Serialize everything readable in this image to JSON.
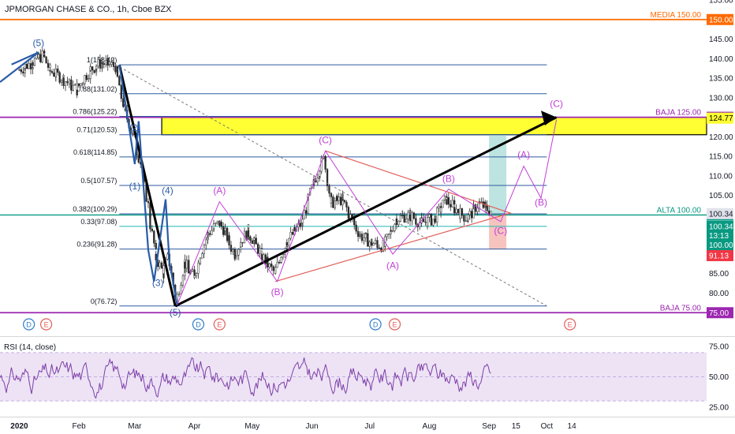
{
  "header": {
    "title": "JPMORGAN CHASE & CO., 1h, Cboe BZX"
  },
  "colors": {
    "candles": "#2a2a2a",
    "wave_black": "#000000",
    "wave_blue": "#2a5ca8",
    "wave_magenta": "#c23fd6",
    "triangle": "#e0605a",
    "fib": "#2f5aa0",
    "fib_33": "#1fb7b0",
    "media": "#ff6a00",
    "baja": "#9c27b0",
    "alta": "#089981",
    "yellow_zone": "#ffff33",
    "teal_box": "#b2dfdb",
    "pink_box": "#f4b8b4",
    "rsi": "#7e3ea8",
    "rsi_band": "#ede3f5"
  },
  "chart_data": {
    "type": "candlestick",
    "symbol": "JPMORGAN CHASE & CO.",
    "interval": "1h",
    "exchange": "Cboe BZX",
    "x_range": [
      "2019-12-22",
      "2020-12-23"
    ],
    "ylim": [
      69,
      155
    ],
    "y_ticks": [
      80,
      85,
      90,
      95,
      100,
      105,
      110,
      115,
      120,
      125,
      130,
      135,
      140,
      145,
      150,
      155
    ],
    "x_ticks": [
      {
        "label": "2020",
        "date": "2020-01-01"
      },
      {
        "label": "Feb",
        "date": "2020-02-01"
      },
      {
        "label": "Mar",
        "date": "2020-03-01"
      },
      {
        "label": "Apr",
        "date": "2020-04-01"
      },
      {
        "label": "May",
        "date": "2020-05-01"
      },
      {
        "label": "Jun",
        "date": "2020-06-01"
      },
      {
        "label": "Jul",
        "date": "2020-07-01"
      },
      {
        "label": "Aug",
        "date": "2020-08-01"
      },
      {
        "label": "Sep",
        "date": "2020-09-01"
      },
      {
        "label": "15",
        "date": "2020-09-15"
      },
      {
        "label": "Oct",
        "date": "2020-10-01"
      },
      {
        "label": "14",
        "date": "2020-10-14"
      }
    ],
    "price_path": [
      [
        "2020-01-01",
        137
      ],
      [
        "2020-01-08",
        139
      ],
      [
        "2020-01-14",
        141
      ],
      [
        "2020-01-17",
        137
      ],
      [
        "2020-01-24",
        135
      ],
      [
        "2020-01-31",
        132
      ],
      [
        "2020-02-07",
        137
      ],
      [
        "2020-02-13",
        139
      ],
      [
        "2020-02-20",
        138
      ],
      [
        "2020-02-25",
        127
      ],
      [
        "2020-03-02",
        118
      ],
      [
        "2020-03-05",
        112
      ],
      [
        "2020-03-09",
        100
      ],
      [
        "2020-03-12",
        90
      ],
      [
        "2020-03-16",
        85
      ],
      [
        "2020-03-19",
        90
      ],
      [
        "2020-03-23",
        77
      ],
      [
        "2020-03-27",
        88
      ],
      [
        "2020-04-01",
        84
      ],
      [
        "2020-04-08",
        95
      ],
      [
        "2020-04-14",
        98
      ],
      [
        "2020-04-17",
        96
      ],
      [
        "2020-04-22",
        90
      ],
      [
        "2020-04-29",
        96
      ],
      [
        "2020-05-06",
        90
      ],
      [
        "2020-05-13",
        85
      ],
      [
        "2020-05-19",
        93
      ],
      [
        "2020-05-27",
        98
      ],
      [
        "2020-06-02",
        108
      ],
      [
        "2020-06-08",
        115
      ],
      [
        "2020-06-11",
        103
      ],
      [
        "2020-06-17",
        104
      ],
      [
        "2020-06-26",
        95
      ],
      [
        "2020-07-02",
        93
      ],
      [
        "2020-07-09",
        92
      ],
      [
        "2020-07-15",
        99
      ],
      [
        "2020-07-22",
        100
      ],
      [
        "2020-07-28",
        98
      ],
      [
        "2020-08-04",
        99
      ],
      [
        "2020-08-10",
        104
      ],
      [
        "2020-08-14",
        102
      ],
      [
        "2020-08-21",
        99
      ],
      [
        "2020-08-27",
        103
      ],
      [
        "2020-09-02",
        101
      ]
    ],
    "horizontal_levels": [
      {
        "name": "MEDIA",
        "label": "MEDIA 150.00",
        "price": 150.0,
        "tag": "150.00",
        "color": "#ff6a00"
      },
      {
        "name": "BAJA",
        "label": "BAJA 125.00",
        "price": 125.0,
        "tag": "125.00",
        "color": "#9c27b0"
      },
      {
        "name": "ALTA",
        "label": "ALTA 100.00",
        "price": 100.0,
        "tag": "100.00",
        "color": "#089981"
      },
      {
        "name": "BAJA",
        "label": "BAJA 75.00",
        "price": 75.0,
        "tag": "75.00",
        "color": "#9c27b0"
      }
    ],
    "fib_levels": [
      {
        "label": "1(138.42)",
        "price": 138.42
      },
      {
        "label": "0.88(131.02)",
        "price": 131.02
      },
      {
        "label": "0.786(125.22)",
        "price": 125.22
      },
      {
        "label": "0.71(120.53)",
        "price": 120.53
      },
      {
        "label": "0.618(114.85)",
        "price": 114.85
      },
      {
        "label": "0.5(107.57)",
        "price": 107.57
      },
      {
        "label": "0.382(100.29)",
        "price": 100.29
      },
      {
        "label": "0.33(97.08)",
        "price": 97.08
      },
      {
        "label": "0.236(91.28)",
        "price": 91.28
      },
      {
        "label": "0(76.72)",
        "price": 76.72
      }
    ],
    "price_tags": [
      {
        "text": "124.77",
        "price": 124.77,
        "style": "yellow"
      },
      {
        "text": "100.34",
        "price": 100.34,
        "style": "grey"
      },
      {
        "text": "100.34",
        "price": 97.1,
        "style": "green"
      },
      {
        "text": "13:13",
        "price": 94.7,
        "style": "green"
      },
      {
        "text": "100.00",
        "price": 92.3,
        "style": "green"
      },
      {
        "text": "91.13",
        "price": 89.6,
        "style": "red"
      }
    ],
    "wave_labels": [
      {
        "text": "(5)",
        "date": "2020-01-11",
        "price": 143.2,
        "color": "#2a5ca8"
      },
      {
        "text": "(2)",
        "date": "2020-03-01",
        "price": 121.5,
        "color": "#2a5ca8"
      },
      {
        "text": "(1)",
        "date": "2020-03-01",
        "price": 106.5,
        "color": "#2a5ca8"
      },
      {
        "text": "(4)",
        "date": "2020-03-18",
        "price": 105.4,
        "color": "#2a5ca8"
      },
      {
        "text": "(3)",
        "date": "2020-03-13",
        "price": 81.8,
        "color": "#2a5ca8"
      },
      {
        "text": "(5)",
        "date": "2020-03-22",
        "price": 74.2,
        "color": "#2a5ca8"
      },
      {
        "text": "(A)",
        "date": "2020-04-14",
        "price": 105.4,
        "color": "#c23fd6"
      },
      {
        "text": "(B)",
        "date": "2020-05-14",
        "price": 79.5,
        "color": "#c23fd6"
      },
      {
        "text": "(C)",
        "date": "2020-06-08",
        "price": 118.4,
        "color": "#c23fd6"
      },
      {
        "text": "(A)",
        "date": "2020-07-13",
        "price": 86.3,
        "color": "#c23fd6"
      },
      {
        "text": "(B)",
        "date": "2020-08-11",
        "price": 108.5,
        "color": "#c23fd6"
      },
      {
        "text": "(C)",
        "date": "2020-09-07",
        "price": 95.1,
        "color": "#c23fd6"
      },
      {
        "text": "(A)",
        "date": "2020-09-19",
        "price": 114.6,
        "color": "#c23fd6"
      },
      {
        "text": "(B)",
        "date": "2020-09-28",
        "price": 102.4,
        "color": "#c23fd6"
      },
      {
        "text": "(C)",
        "date": "2020-10-06",
        "price": 127.6,
        "color": "#c23fd6"
      }
    ],
    "events": [
      {
        "letter": "D",
        "date": "2020-01-06",
        "kind": "dividend"
      },
      {
        "letter": "E",
        "date": "2020-01-15",
        "kind": "earnings"
      },
      {
        "letter": "D",
        "date": "2020-04-03",
        "kind": "dividend"
      },
      {
        "letter": "E",
        "date": "2020-04-14",
        "kind": "earnings"
      },
      {
        "letter": "D",
        "date": "2020-07-04",
        "kind": "dividend"
      },
      {
        "letter": "E",
        "date": "2020-07-14",
        "kind": "earnings"
      },
      {
        "letter": "E",
        "date": "2020-10-13",
        "kind": "earnings"
      }
    ],
    "rsi": {
      "label": "RSI (14, close)",
      "ylim": [
        17,
        83
      ],
      "y_ticks": [
        25.0,
        50.0,
        75.0
      ],
      "band": [
        30,
        70
      ]
    }
  }
}
